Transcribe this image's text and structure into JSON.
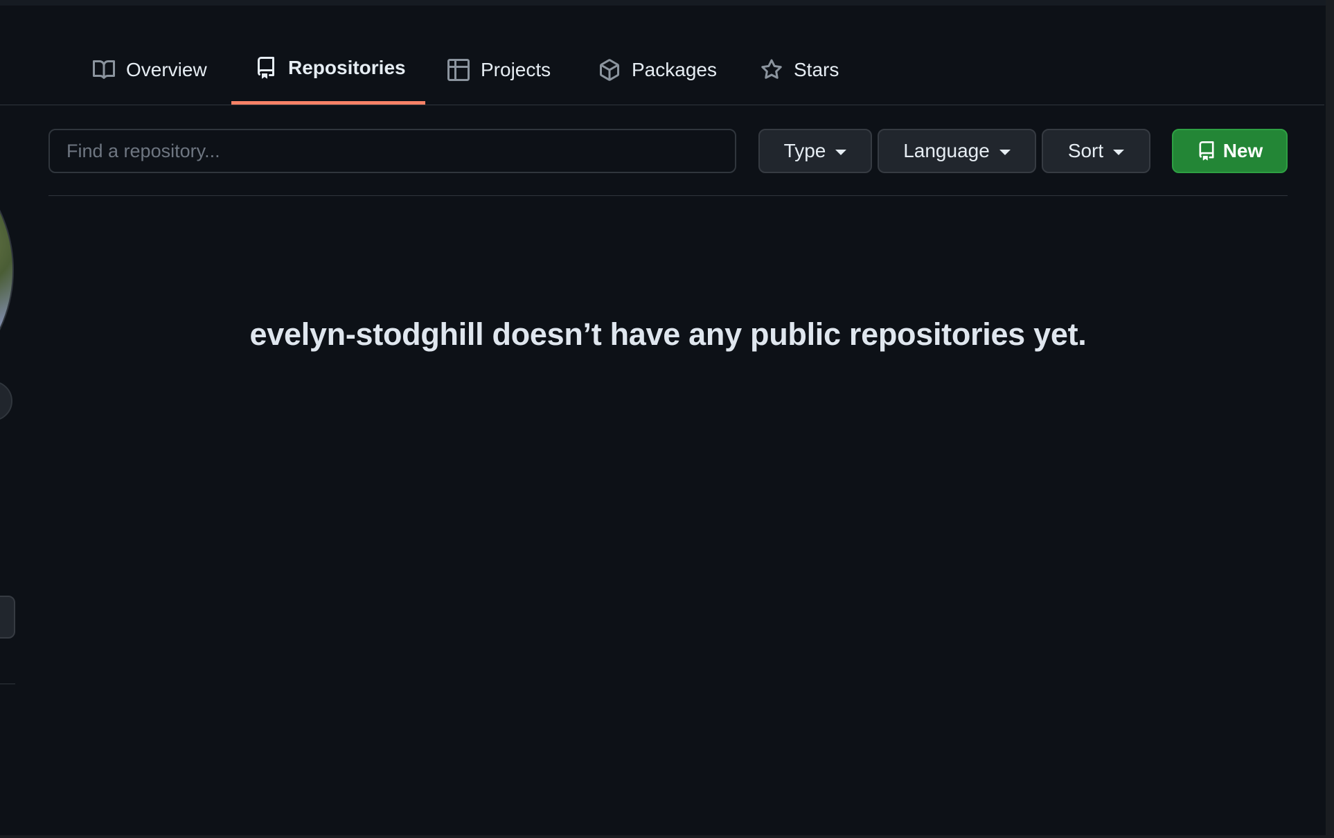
{
  "tabs": [
    {
      "label": "Overview",
      "icon": "book-icon",
      "selected": false
    },
    {
      "label": "Repositories",
      "icon": "repo-icon",
      "selected": true
    },
    {
      "label": "Projects",
      "icon": "table-icon",
      "selected": false
    },
    {
      "label": "Packages",
      "icon": "package-icon",
      "selected": false
    },
    {
      "label": "Stars",
      "icon": "star-icon",
      "selected": false
    }
  ],
  "filters": {
    "search_placeholder": "Find a repository...",
    "type_label": "Type",
    "language_label": "Language",
    "sort_label": "Sort",
    "new_label": "New"
  },
  "blankslate": {
    "message": "evelyn-stodghill doesn’t have any public repositories yet."
  },
  "colors": {
    "background": "#0d1117",
    "selected_tab_underline": "#f78166",
    "new_button": "#238636",
    "button_bg": "#21262d",
    "border": "#30363d"
  }
}
